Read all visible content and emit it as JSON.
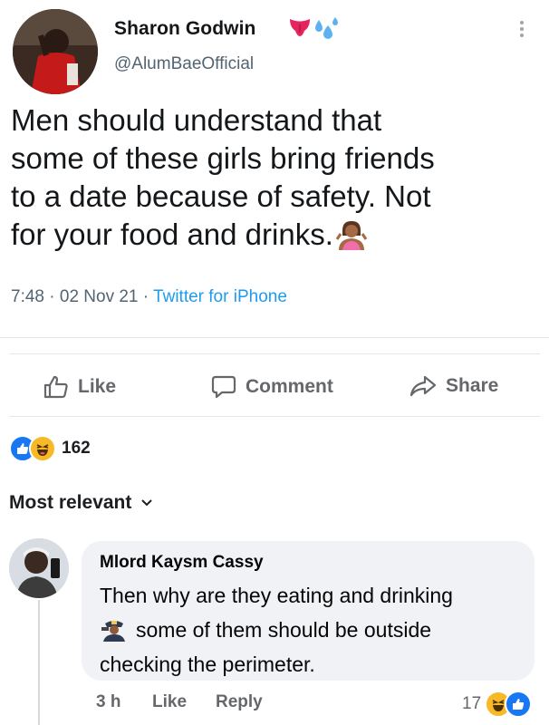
{
  "tweet": {
    "author_name": "Sharon Godwin",
    "author_emojis": [
      "tongue-emoji",
      "sweat-droplets-emoji"
    ],
    "handle": "@AlumBaeOfficial",
    "text_lines": [
      "Men should understand that",
      "some of these girls bring friends",
      "to a date because of safety. Not",
      "for your food and drinks."
    ],
    "trailing_emoji": "person-shrugging-emoji",
    "time": "7:48",
    "date": "02 Nov 21",
    "source": "Twitter for iPhone",
    "separator": "·"
  },
  "post_actions": {
    "like": "Like",
    "comment": "Comment",
    "share": "Share"
  },
  "reactions": {
    "types": [
      "like-reaction",
      "haha-reaction"
    ],
    "count": "162"
  },
  "sort_label": "Most relevant",
  "comment": {
    "author": "Mlord Kaysm Cassy",
    "text_line1": "Then why are they eating and drinking",
    "text_line2": "some of them should be outside",
    "text_line3": "checking the perimeter.",
    "inline_emoji": "police-officer-emoji",
    "time": "3 h",
    "like": "Like",
    "reply": "Reply",
    "reaction_count": "17",
    "reaction_types": [
      "haha-reaction",
      "like-reaction"
    ]
  },
  "colors": {
    "twitter_blue": "#1d9bf0",
    "facebook_blue": "#1877f2",
    "muted_gray": "#65676b",
    "bubble_bg": "#f0f2f5"
  }
}
